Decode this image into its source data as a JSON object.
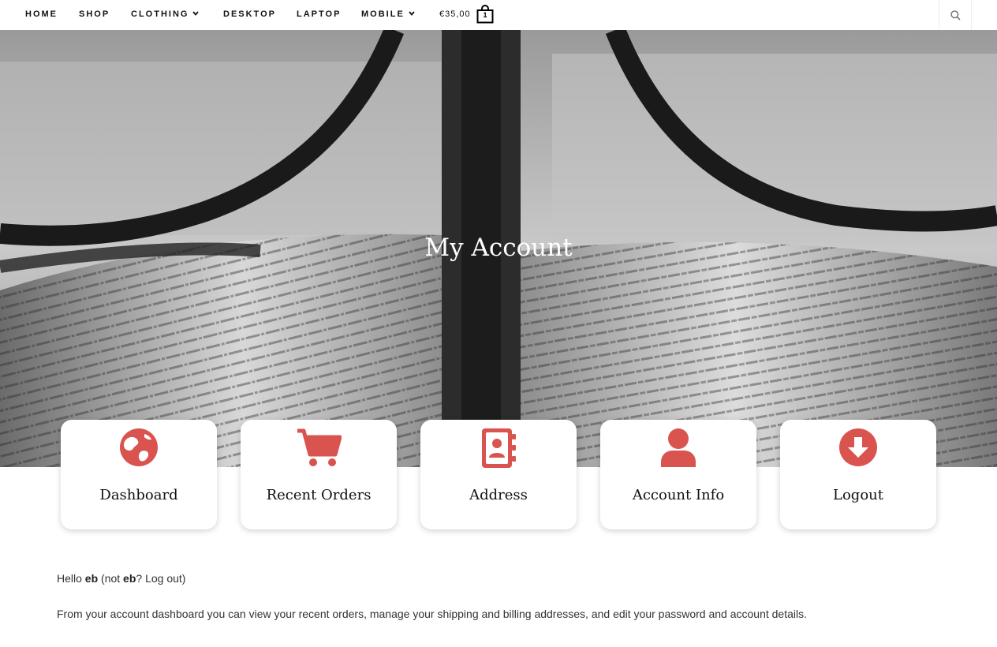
{
  "nav": {
    "items": [
      {
        "label": "HOME"
      },
      {
        "label": "SHOP"
      },
      {
        "label": "CLOTHING"
      },
      {
        "label": "DESKTOP"
      },
      {
        "label": "LAPTOP"
      },
      {
        "label": "MOBILE"
      }
    ],
    "cart_total": "€35,00",
    "cart_count": "1",
    "search_icon": "search-icon"
  },
  "hero": {
    "title": "My Account"
  },
  "account_nav": [
    {
      "label": "Dashboard",
      "icon": "globe-icon"
    },
    {
      "label": "Recent Orders",
      "icon": "cart-icon"
    },
    {
      "label": "Address",
      "icon": "address-book-icon"
    },
    {
      "label": "Account Info",
      "icon": "user-icon"
    },
    {
      "label": "Logout",
      "icon": "download-circle-icon"
    }
  ],
  "content": {
    "hello": "Hello",
    "username": "eb",
    "not_prefix": "(not",
    "not_user": "eb",
    "logout_text": "? Log out)",
    "description": "From your account dashboard you can view your recent orders, manage your shipping and billing addresses, and edit your password and account details."
  },
  "colors": {
    "accent": "#d9534f",
    "text": "#333333",
    "nav_text": "#111111"
  }
}
